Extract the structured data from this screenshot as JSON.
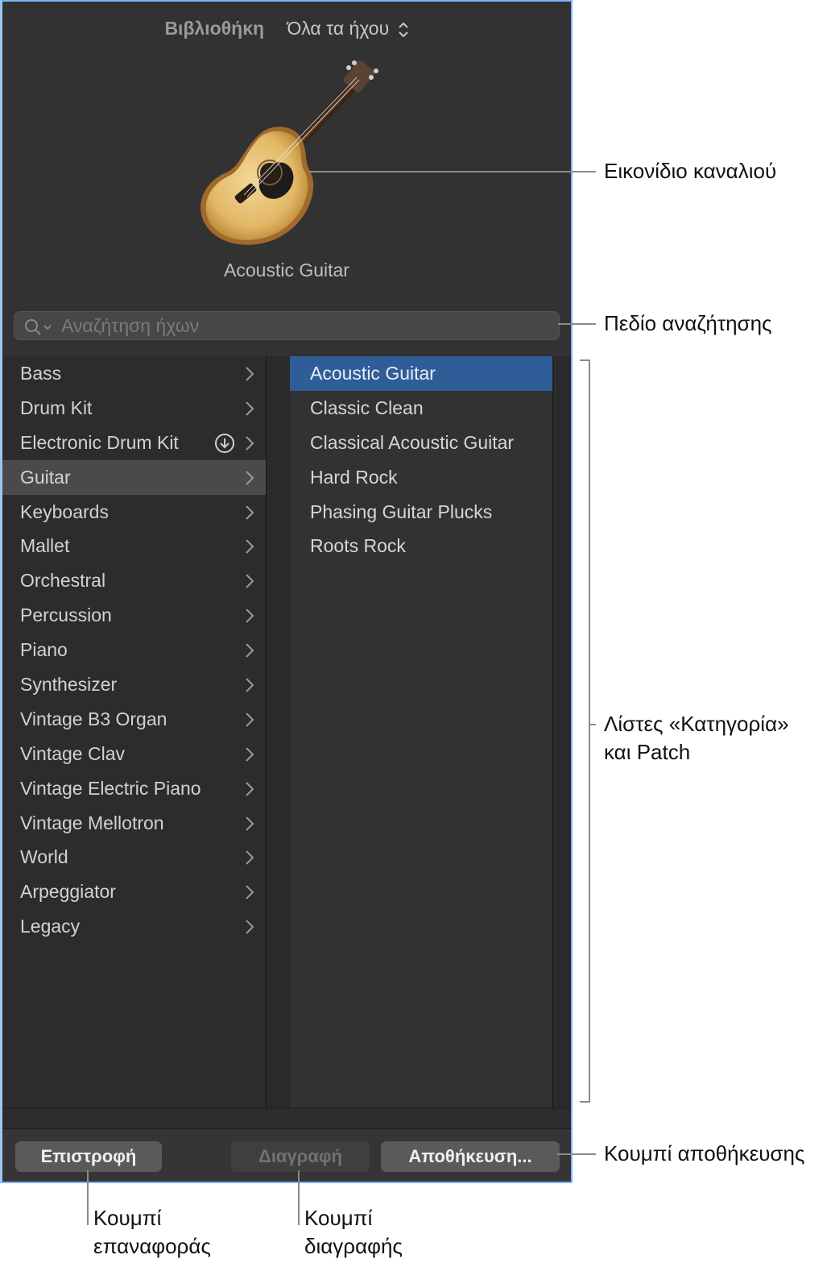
{
  "header": {
    "library_label": "Βιβλιοθήκη",
    "sound_filter": "Όλα τα ήχου"
  },
  "channel": {
    "name": "Acoustic Guitar"
  },
  "search": {
    "placeholder": "Αναζήτηση ήχων"
  },
  "categories": [
    {
      "label": "Bass"
    },
    {
      "label": "Drum Kit"
    },
    {
      "label": "Electronic Drum Kit",
      "download": true
    },
    {
      "label": "Guitar",
      "selected": true
    },
    {
      "label": "Keyboards"
    },
    {
      "label": "Mallet"
    },
    {
      "label": "Orchestral"
    },
    {
      "label": "Percussion"
    },
    {
      "label": "Piano"
    },
    {
      "label": "Synthesizer"
    },
    {
      "label": "Vintage B3 Organ"
    },
    {
      "label": "Vintage Clav"
    },
    {
      "label": "Vintage Electric Piano"
    },
    {
      "label": "Vintage Mellotron"
    },
    {
      "label": "World"
    },
    {
      "label": "Arpeggiator"
    },
    {
      "label": "Legacy"
    }
  ],
  "patches": [
    {
      "label": "Acoustic Guitar",
      "selected": true
    },
    {
      "label": "Classic Clean"
    },
    {
      "label": "Classical Acoustic Guitar"
    },
    {
      "label": "Hard Rock"
    },
    {
      "label": "Phasing Guitar Plucks"
    },
    {
      "label": "Roots Rock"
    }
  ],
  "footer": {
    "revert_label": "Επιστροφή",
    "delete_label": "Διαγραφή",
    "save_label": "Αποθήκευση..."
  },
  "callouts": {
    "channel_icon": "Εικονίδιο καναλιού",
    "search_field": "Πεδίο αναζήτησης",
    "lists_line1": "Λίστες «Κατηγορία»",
    "lists_line2": "και Patch",
    "save_button": "Κουμπί αποθήκευσης",
    "revert_line1": "Κουμπί",
    "revert_line2": "επαναφοράς",
    "delete_line1": "Κουμπί",
    "delete_line2": "διαγραφής"
  },
  "colors": {
    "panel_bg": "#2e2e2e",
    "selected_patch": "#2f5d98",
    "selected_category": "#4a4a4a",
    "panel_border": "#7db4f5"
  }
}
